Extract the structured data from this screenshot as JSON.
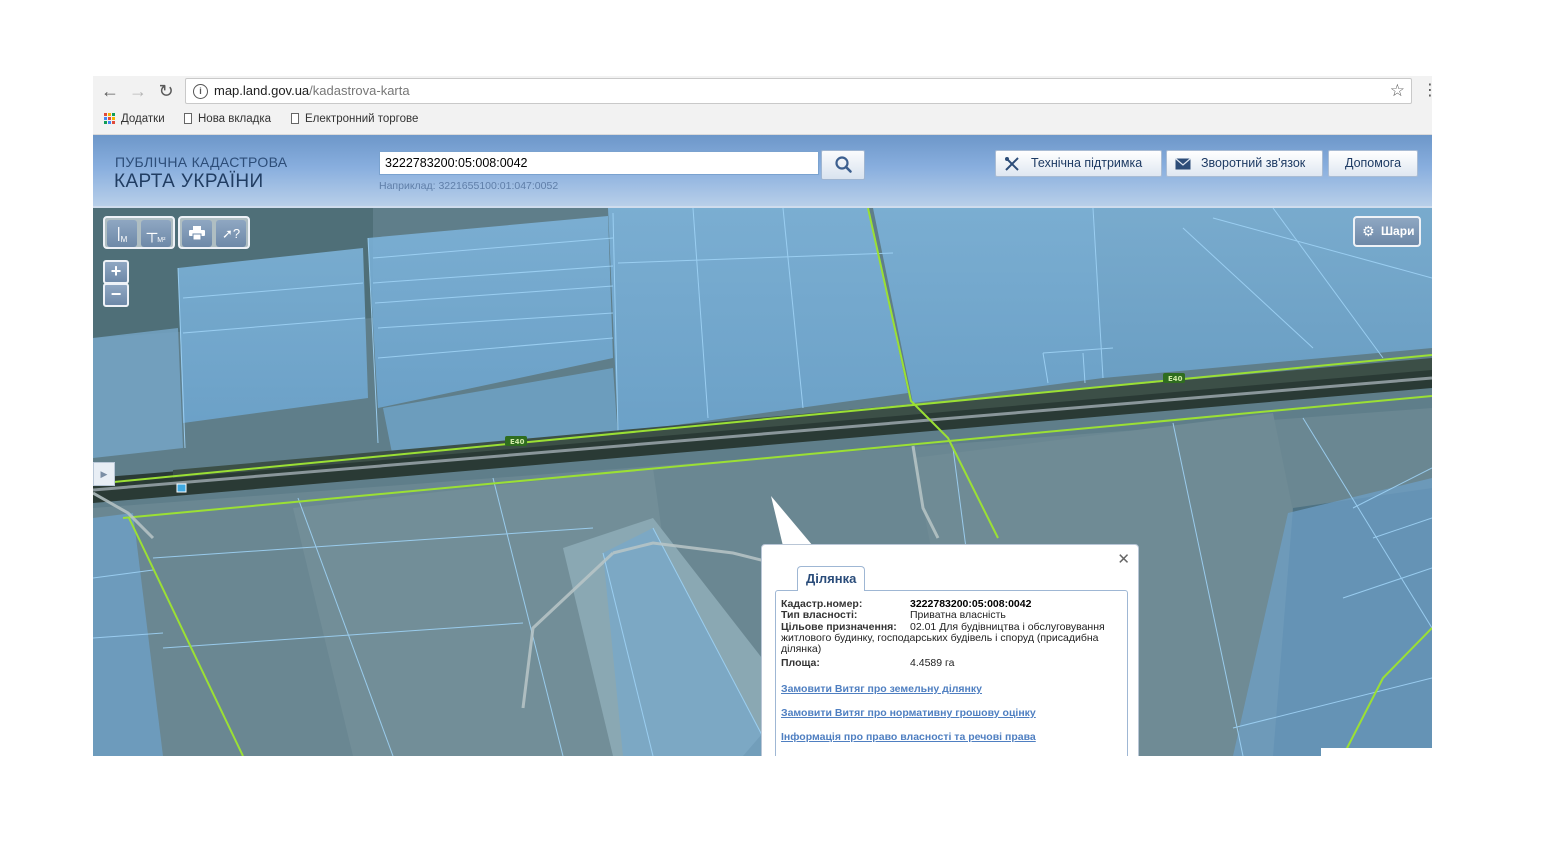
{
  "browser": {
    "url_host": "map.land.gov.ua",
    "url_path": "/kadastrova-karta",
    "bookmarks": [
      "Додатки",
      "Нова вкладка",
      "Електронний торгове"
    ]
  },
  "header": {
    "logo_line1": "ПУБЛІЧНА КАДАСТРОВА",
    "logo_line2": "КАРТА УКРАЇНИ",
    "search_value": "3222783200:05:008:0042",
    "search_hint": "Наприклад: 3221655100:01:047:0052",
    "buttons": {
      "support": "Технічна підтримка",
      "feedback": "Зворотний зв'язок",
      "help": "Допомога"
    }
  },
  "map": {
    "tools": {
      "measure_line_sub": "М",
      "measure_area_sub": "М²"
    },
    "zoom_in": "+",
    "zoom_out": "−",
    "layers_label": "Шари",
    "road_labels": [
      "Е40",
      "Е40"
    ]
  },
  "popup": {
    "tab_label": "Ділянка",
    "fields": [
      {
        "key": "Кадастр.номер:",
        "value": "3222783200:05:008:0042"
      },
      {
        "key": "Тип власності:",
        "value": "Приватна власність"
      },
      {
        "key": "Цільове призначення:",
        "value": "02.01 Для будівництва і обслуговування житлового будинку, господарських будівель і споруд (присадибна ділянка)"
      },
      {
        "key": "Площа:",
        "value": "4.4589 га"
      }
    ],
    "links": [
      "Замовити Витяг про земельну ділянку",
      "Замовити Витяг про нормативну грошову оцінку",
      "Інформація про право власності та речові права"
    ]
  }
}
